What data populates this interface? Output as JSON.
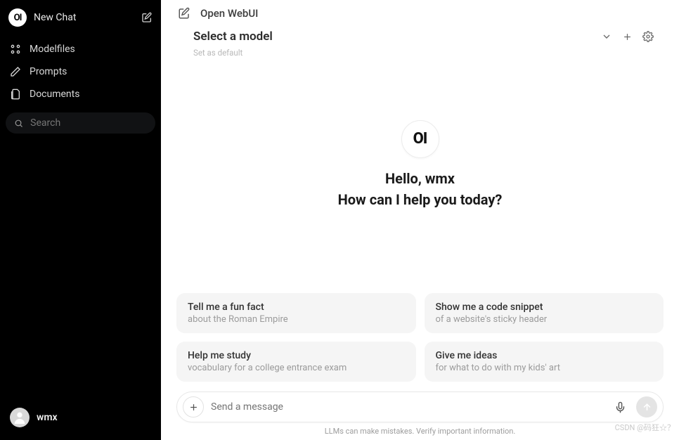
{
  "sidebar": {
    "logo_text": "OI",
    "new_chat_label": "New Chat",
    "nav": [
      {
        "label": "Modelfiles"
      },
      {
        "label": "Prompts"
      },
      {
        "label": "Documents"
      }
    ],
    "search_placeholder": "Search",
    "user_name": "wmx"
  },
  "header": {
    "app_title": "Open WebUI",
    "model_select_label": "Select a model",
    "set_default_label": "Set as default"
  },
  "center": {
    "logo_text": "OI",
    "greeting_line1": "Hello, wmx",
    "greeting_line2": "How can I help you today?"
  },
  "suggestions": [
    {
      "title": "Tell me a fun fact",
      "sub": "about the Roman Empire"
    },
    {
      "title": "Show me a code snippet",
      "sub": "of a website's sticky header"
    },
    {
      "title": "Help me study",
      "sub": "vocabulary for a college entrance exam"
    },
    {
      "title": "Give me ideas",
      "sub": "for what to do with my kids' art"
    }
  ],
  "input": {
    "placeholder": "Send a message"
  },
  "footer": {
    "disclaimer": "LLMs can make mistakes. Verify important information."
  },
  "watermark": "CSDN @码狂☆？"
}
